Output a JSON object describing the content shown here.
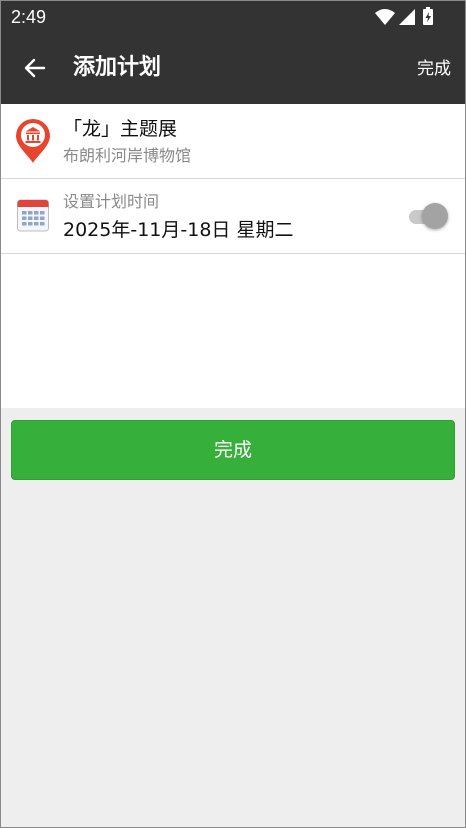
{
  "status_bar": {
    "time": "2:49"
  },
  "toolbar": {
    "back_icon": "arrow-left-icon",
    "title": "添加计划",
    "done_label": "完成"
  },
  "venue": {
    "icon": "museum-pin-icon",
    "icon_color": "#e8452f",
    "title": "「龙」主题展",
    "subtitle": "布朗利河岸博物馆"
  },
  "schedule": {
    "icon": "calendar-icon",
    "label": "设置计划时间",
    "date": "2025年-11月-18日 星期二",
    "toggle_on": false
  },
  "primary_button": {
    "label": "完成",
    "color": "#36b03a"
  }
}
